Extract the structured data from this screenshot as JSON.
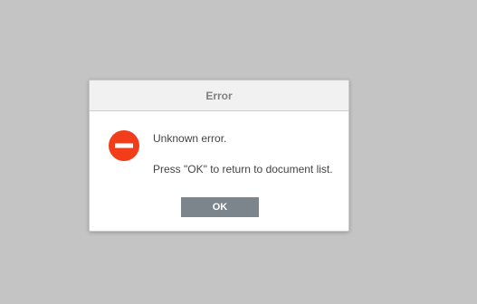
{
  "dialog": {
    "title": "Error",
    "message_line_1": "Unknown error.",
    "message_line_2": "Press \"OK\" to return to document list.",
    "ok_label": "OK",
    "icon": "error-stop-icon",
    "icon_color": "#f23d1a"
  },
  "colors": {
    "backdrop": "#c4c4c4",
    "button": "#7d858c"
  }
}
